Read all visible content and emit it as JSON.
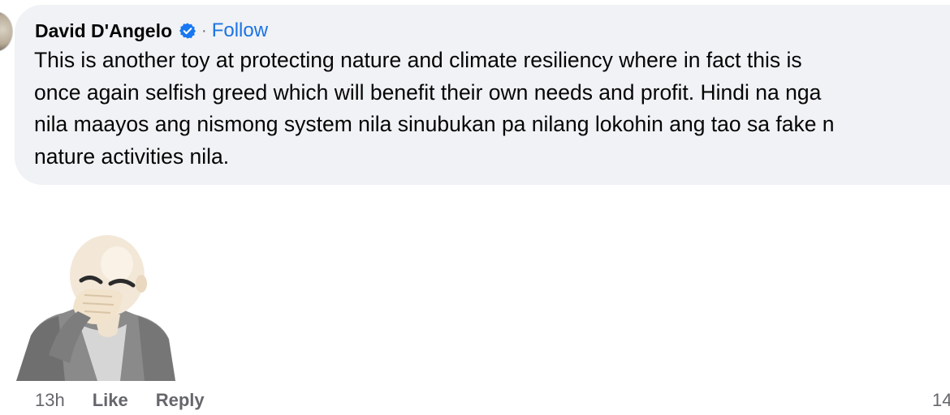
{
  "comment": {
    "author": "David D'Angelo",
    "verified_icon": "verified-badge-icon",
    "separator": "·",
    "follow_label": "Follow",
    "text_lines": [
      "This is another toy at protecting nature and climate resiliency where in fact this is",
      "once again selfish greed which will benefit their own needs and profit. Hindi na nga",
      "nila maayos ang nismong system nila sinubukan pa nilang lokohin ang tao sa fake n",
      "nature activities nila."
    ],
    "sticker_icon": "facepalm-avatar-sticker",
    "timestamp": "13h",
    "like_label": "Like",
    "reply_label": "Reply",
    "reaction_count": "14"
  },
  "colors": {
    "bubble": "#f0f2f5",
    "link": "#1b74e4",
    "meta_text": "#65676b",
    "verified": "#1877f2"
  }
}
